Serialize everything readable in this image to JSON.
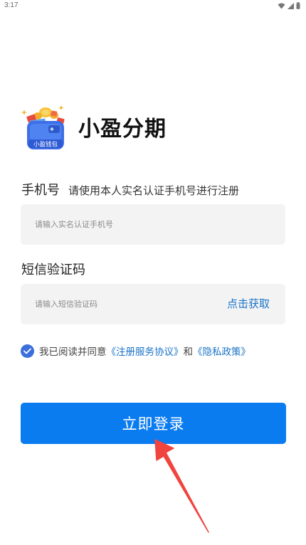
{
  "status_bar": {
    "time": "3:17",
    "icons": [
      "wifi-icon",
      "signal-icon",
      "battery-icon"
    ]
  },
  "app": {
    "name": "小盈分期",
    "logo_text": "小盈钱包"
  },
  "phone": {
    "label": "手机号",
    "hint": "请使用本人实名认证手机号进行注册",
    "placeholder": "请输入实名认证手机号",
    "value": ""
  },
  "sms": {
    "label": "短信验证码",
    "placeholder": "请输入短信验证码",
    "value": "",
    "get_code_label": "点击获取"
  },
  "agreement": {
    "checked": true,
    "prefix": "我已阅读并同意",
    "link_terms": "《注册服务协议》",
    "conjunction": "和",
    "link_privacy": "《隐私政策》"
  },
  "login_button": {
    "label": "立即登录"
  },
  "colors": {
    "primary": "#0a7cf0",
    "link": "#1a73c8",
    "checkbox": "#3b6fdc",
    "input_bg": "#f3f3f3",
    "annotation_arrow": "#f0443f"
  }
}
